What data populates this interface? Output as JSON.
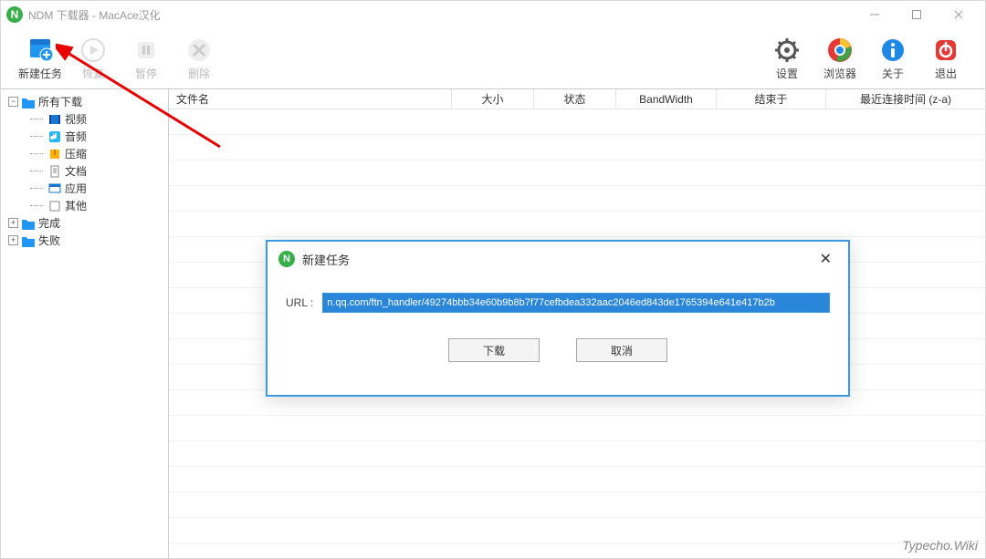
{
  "window": {
    "title": "NDM 下载器 - MacAce汉化"
  },
  "toolbar": {
    "new_task": "新建任务",
    "resume": "恢复",
    "pause": "暂停",
    "delete": "删除",
    "settings": "设置",
    "browser": "浏览器",
    "about": "关于",
    "exit": "退出"
  },
  "sidebar": {
    "all_downloads": "所有下载",
    "categories": {
      "video": "视频",
      "audio": "音频",
      "archive": "压缩",
      "document": "文档",
      "application": "应用",
      "other": "其他"
    },
    "completed": "完成",
    "failed": "失败"
  },
  "columns": {
    "filename": "文件名",
    "size": "大小",
    "status": "状态",
    "bandwidth": "BandWidth",
    "end_time": "结束于",
    "last_conn": "最近连接时间 (z-a)"
  },
  "dialog": {
    "title": "新建任务",
    "url_label": "URL :",
    "url_value": "n.qq.com/ftn_handler/49274bbb34e60b9b8b7f77cefbdea332aac2046ed843de1765394e641e417b2b",
    "download": "下载",
    "cancel": "取消"
  },
  "watermark": "Typecho.Wiki"
}
